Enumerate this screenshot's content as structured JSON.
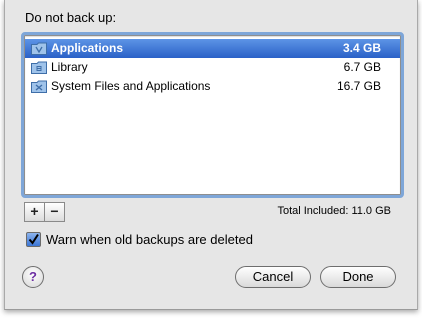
{
  "dialog": {
    "heading": "Do not back up:",
    "items": [
      {
        "name": "Applications",
        "size": "3.4 GB",
        "icon": "applications-folder-icon",
        "selected": true
      },
      {
        "name": "Library",
        "size": "6.7 GB",
        "icon": "library-folder-icon",
        "selected": false
      },
      {
        "name": "System Files and Applications",
        "size": "16.7 GB",
        "icon": "system-folder-icon",
        "selected": false
      }
    ],
    "add_label": "+",
    "remove_label": "−",
    "total_included": "Total Included: 11.0 GB",
    "warn_label": "Warn when old backups are deleted",
    "warn_checked": true,
    "help_label": "?",
    "cancel_label": "Cancel",
    "done_label": "Done"
  },
  "colors": {
    "selection": "#2d63c9",
    "focus_ring": "#7ea6d8",
    "help_glyph": "#6d2fa3"
  }
}
